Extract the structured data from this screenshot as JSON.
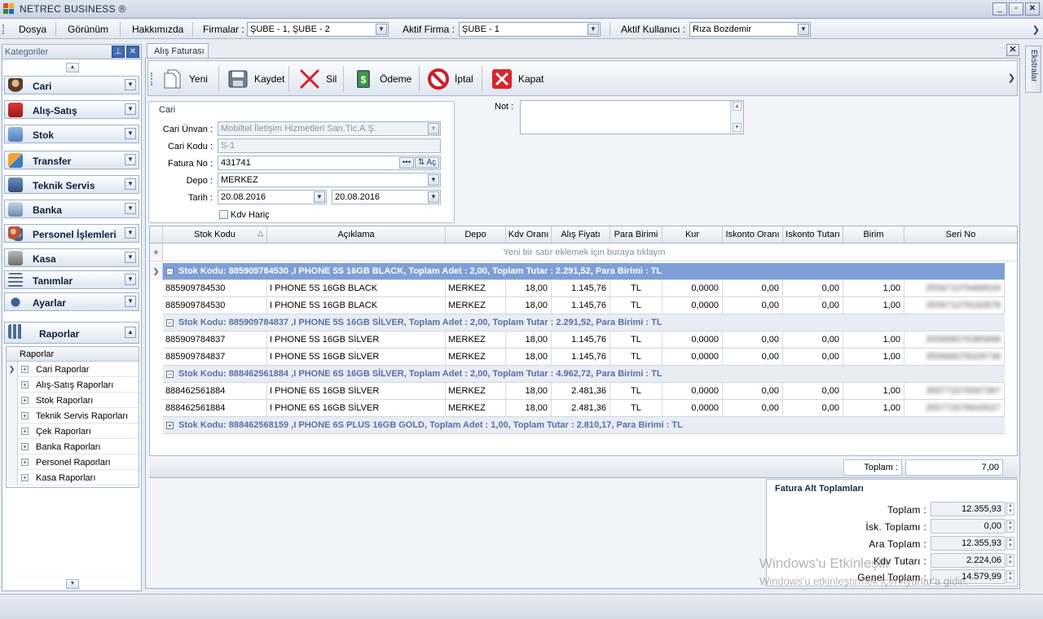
{
  "app": {
    "title": "NETREC BUSINESS ®"
  },
  "window_buttons": {
    "minimize": "_",
    "restore": "▫",
    "close": "✕"
  },
  "menu": {
    "items": [
      "Dosya",
      "Görünüm",
      "Hakkımızda"
    ],
    "firmalar_label": "Firmalar :",
    "firmalar_value": "ŞUBE - 1, ŞUBE - 2",
    "aktif_firma_label": "Aktif Firma :",
    "aktif_firma_value": "ŞUBE - 1",
    "aktif_kullanici_label": "Aktif Kullanıcı :",
    "aktif_kullanici_value": "Rıza Bozdemir"
  },
  "sidebar": {
    "title": "Kategoriler",
    "categories": [
      {
        "label": "Cari",
        "color": "#8a4a2c"
      },
      {
        "label": "Alış-Satış",
        "color": "#c0262b"
      },
      {
        "label": "Stok",
        "color": "#4f7fb8"
      },
      {
        "label": "Transfer",
        "color": "#d8862a"
      },
      {
        "label": "Teknik Servis",
        "color": "#4c6f9c"
      },
      {
        "label": "Banka",
        "color": "#6b88b0"
      },
      {
        "label": "Personel İşlemleri",
        "color": "#b4563b"
      },
      {
        "label": "Kasa",
        "color": "#7a7a7a"
      },
      {
        "label": "Tanımlar",
        "color": "#5a6e8a"
      },
      {
        "label": "Ayarlar",
        "color": "#3f5f8f"
      },
      {
        "label": "Raporlar",
        "color": "#4a6f96"
      }
    ],
    "tree_header": "Raporlar",
    "tree_items": [
      "Cari Raporlar",
      "Alış-Satış Raporları",
      "Stok Raporları",
      "Teknik Servis Raporları",
      "Çek Raporları",
      "Banka Raporları",
      "Personel Raporları",
      "Kasa Raporları"
    ]
  },
  "right_tab": {
    "label": "Ekstralar"
  },
  "document": {
    "tab_label": "Alış Faturası",
    "toolbar": {
      "yeni": "Yeni",
      "kaydet": "Kaydet",
      "sil": "Sil",
      "odeme": "Ödeme",
      "iptal": "İptal",
      "kapat": "Kapat"
    },
    "cari_group": {
      "title": "Cari",
      "cari_unvan_label": "Cari Ünvan :",
      "cari_unvan_value": "Mobiltel İletişim Hizmetleri San.Tic.A.Ş.",
      "cari_kodu_label": "Cari Kodu :",
      "cari_kodu_value": "S-1",
      "fatura_no_label": "Fatura No :",
      "fatura_no_value": "431741",
      "fatura_ac": "Aç",
      "depo_label": "Depo :",
      "depo_value": "MERKEZ",
      "tarih_label": "Tarih :",
      "tarih_value1": "20.08.2016",
      "tarih_value2": "20.08.2016",
      "kdv_haric": "Kdv Hariç"
    },
    "not_label": "Not :",
    "grid": {
      "columns": [
        "Stok Kodu",
        "Açıklama",
        "Depo",
        "Kdv Oranı",
        "Alış Fiyatı",
        "Para Birimi",
        "Kur",
        "Iskonto Oranı",
        "Iskonto Tutarı",
        "Birim",
        "Seri No"
      ],
      "new_row_text": "Yeni bir satır eklemek için buraya tıklayın",
      "groups": [
        {
          "header": "Stok Kodu: 885909784530 ,I PHONE 5S 16GB BLACK, Toplam Adet : 2,00, Toplam Tutar : 2.291,52, Para Birimi : TL",
          "expanded": true,
          "rows": [
            {
              "stok": "885909784530",
              "aciklama": "I PHONE 5S 16GB BLACK",
              "depo": "MERKEZ",
              "kdv": "18,00",
              "fiyat": "1.145,76",
              "pb": "TL",
              "kur": "0,0000",
              "isk_oran": "0,00",
              "isk_tutar": "0,00",
              "birim": "1,00",
              "seri": "355671079466534"
            },
            {
              "stok": "885909784530",
              "aciklama": "I PHONE 5S 16GB BLACK",
              "depo": "MERKEZ",
              "kdv": "18,00",
              "fiyat": "1.145,76",
              "pb": "TL",
              "kur": "0,0000",
              "isk_oran": "0,00",
              "isk_tutar": "0,00",
              "birim": "1,00",
              "seri": "355671079182878"
            }
          ]
        },
        {
          "header": "Stok Kodu: 885909784837 ,I PHONE 5S 16GB SİLVER, Toplam Adet : 2,00, Toplam Tutar : 2.291,52, Para Birimi : TL",
          "expanded": true,
          "rows": [
            {
              "stok": "885909784837",
              "aciklama": "I PHONE 5S 16GB SİLVER",
              "depo": "MERKEZ",
              "kdv": "18,00",
              "fiyat": "1.145,76",
              "pb": "TL",
              "kur": "0,0000",
              "isk_oran": "0,00",
              "isk_tutar": "0,00",
              "birim": "1,00",
              "seri": "355668079385898"
            },
            {
              "stok": "885909784837",
              "aciklama": "I PHONE 5S 16GB SİLVER",
              "depo": "MERKEZ",
              "kdv": "18,00",
              "fiyat": "1.145,76",
              "pb": "TL",
              "kur": "0,0000",
              "isk_oran": "0,00",
              "isk_tutar": "0,00",
              "birim": "1,00",
              "seri": "355668078326738"
            }
          ]
        },
        {
          "header": "Stok Kodu: 888462561884 ,I PHONE 6S 16GB SİLVER, Toplam Adet : 2,00, Toplam Tutar : 4.962,72, Para Birimi : TL",
          "expanded": true,
          "rows": [
            {
              "stok": "888462561884",
              "aciklama": "I PHONE 6S 16GB SİLVER",
              "depo": "MERKEZ",
              "kdv": "18,00",
              "fiyat": "2.481,36",
              "pb": "TL",
              "kur": "0,0000",
              "isk_oran": "0,00",
              "isk_tutar": "0,00",
              "birim": "1,00",
              "seri": "355772076597397"
            },
            {
              "stok": "888462561884",
              "aciklama": "I PHONE 6S 16GB SİLVER",
              "depo": "MERKEZ",
              "kdv": "18,00",
              "fiyat": "2.481,36",
              "pb": "TL",
              "kur": "0,0000",
              "isk_oran": "0,00",
              "isk_tutar": "0,00",
              "birim": "1,00",
              "seri": "355772076643027"
            }
          ]
        },
        {
          "header": "Stok Kodu: 888462568159 ,I PHONE 6S PLUS 16GB GOLD, Toplam Adet : 1,00, Toplam Tutar : 2.810,17, Para Birimi : TL",
          "expanded": false,
          "rows": []
        }
      ],
      "footer_label": "Toplam :",
      "footer_value": "7,00"
    },
    "totals": {
      "title": "Fatura Alt Toplamları",
      "rows": [
        {
          "label": "Toplam :",
          "value": "12.355,93"
        },
        {
          "label": "İsk. Toplamı :",
          "value": "0,00"
        },
        {
          "label": "Ara Toplam :",
          "value": "12.355,93"
        },
        {
          "label": "Kdv Tutarı :",
          "value": "2.224,06"
        },
        {
          "label": "Genel Toplam :",
          "value": "14.579,99"
        }
      ]
    }
  },
  "watermark": {
    "line1": "Windows'u Etkinleştir",
    "line2": "Windows'u etkinleştirmek için Ayarlar'a gidin."
  }
}
